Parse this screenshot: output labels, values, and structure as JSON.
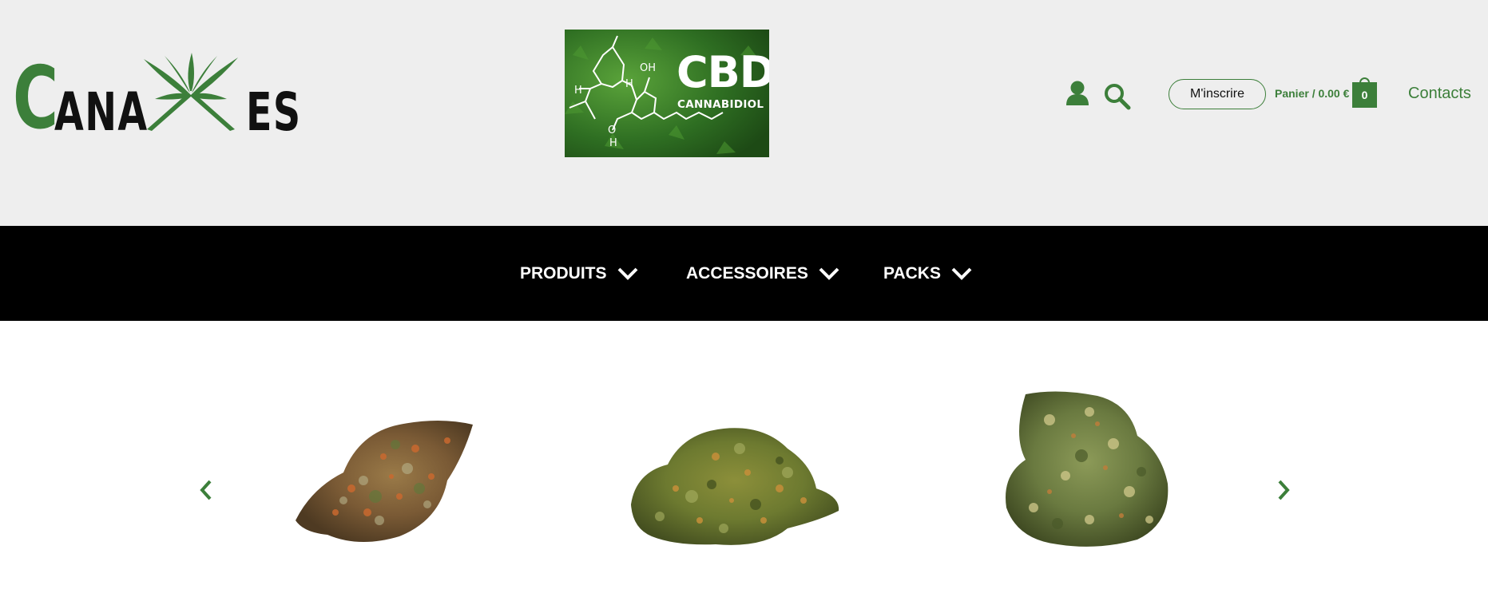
{
  "header": {
    "logo": {
      "letter_c": "C",
      "letters_ana": "ANA",
      "letters_es": "ES",
      "brand_green": "#3c7f3a"
    },
    "banner": {
      "headline": "CBD",
      "subline": "CANNABIDIOL",
      "molecule_labels": [
        "OH",
        "H",
        "H",
        "O",
        "H"
      ]
    },
    "account_icon": "user-icon",
    "search_icon": "search-icon",
    "signup_label": "M'inscrire",
    "cart": {
      "label": "Panier / 0.00 €",
      "count": "0"
    },
    "contacts_label": "Contacts"
  },
  "nav": {
    "items": [
      {
        "label": "PRODUITS"
      },
      {
        "label": "ACCESSOIRES"
      },
      {
        "label": "PACKS"
      }
    ]
  },
  "carousel": {
    "prev_icon": "chevron-left-icon",
    "next_icon": "chevron-right-icon",
    "products": [
      {
        "image": "cannabis-bud-orange"
      },
      {
        "image": "cannabis-bud-green"
      },
      {
        "image": "cannabis-bud-frosty"
      }
    ]
  },
  "colors": {
    "header_bg": "#eeeeee",
    "nav_bg": "#000000",
    "accent": "#3c7f3a"
  }
}
